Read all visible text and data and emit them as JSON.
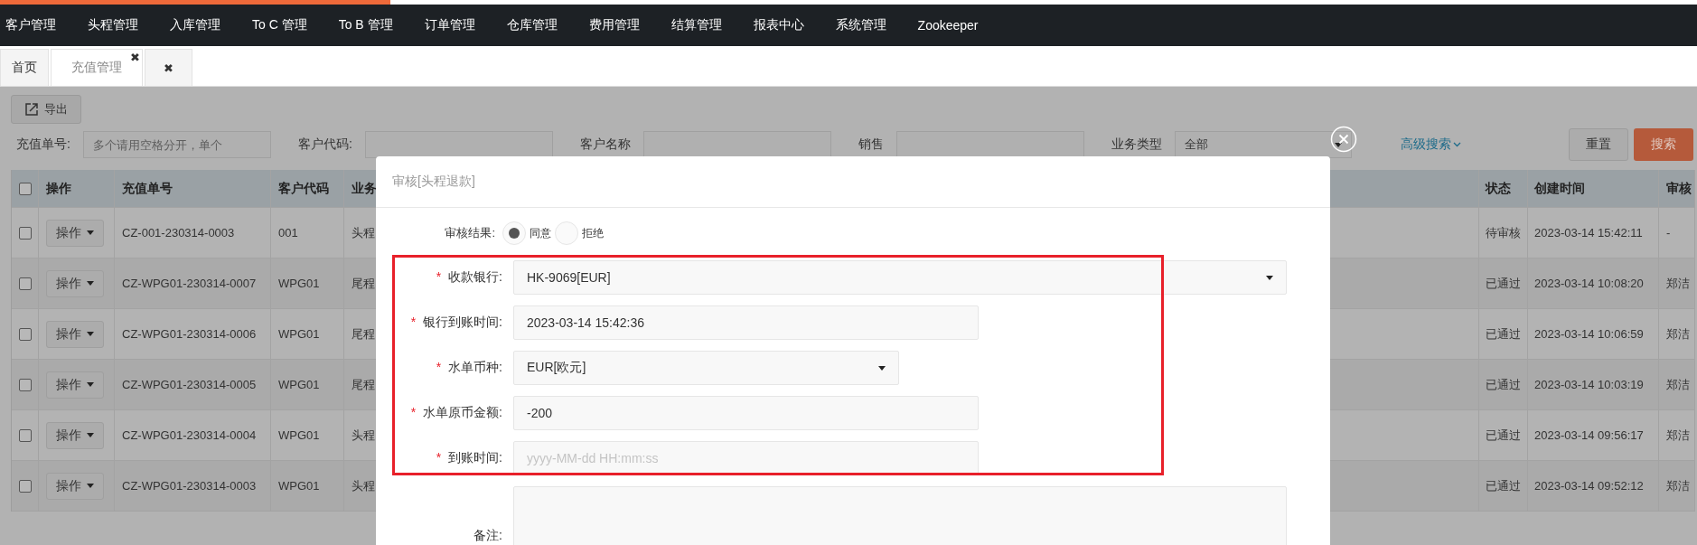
{
  "nav": {
    "items": [
      "客户管理",
      "头程管理",
      "入库管理",
      "To C 管理",
      "To B 管理",
      "订单管理",
      "仓库管理",
      "费用管理",
      "结算管理",
      "报表中心",
      "系统管理",
      "Zookeeper"
    ]
  },
  "tabs": [
    {
      "label": "首页",
      "selected": false
    },
    {
      "label": "充值管理",
      "selected": true,
      "close": "✖"
    },
    {
      "close": "✖",
      "selected": false
    }
  ],
  "toolbar": {
    "export_button": "导出"
  },
  "filters": [
    {
      "label": "充值单号:",
      "placeholder": "多个请用空格分开，单个"
    },
    {
      "label": "客户代码:"
    },
    {
      "label": "客户名称"
    },
    {
      "label": "销售"
    },
    {
      "label": "业务类型",
      "kind": "select",
      "value": "全部"
    }
  ],
  "advanced_search": "高级搜索",
  "reset_button": "重置",
  "search_button": "搜索",
  "table": {
    "select_all": {
      "checked": false
    },
    "columns": [
      "操作",
      "充值单号",
      "客户代码",
      "业务",
      "状态",
      "创建时间",
      "审核"
    ],
    "rows": [
      {
        "checked": false,
        "action": "操作",
        "order_no": "CZ-001-230314-0003",
        "customer_code": "001",
        "business": "头程",
        "status": "待审核",
        "created": "2023-03-14 15:42:11",
        "auditor": "-"
      },
      {
        "checked": false,
        "action": "操作",
        "order_no": "CZ-WPG01-230314-0007",
        "customer_code": "WPG01",
        "business": "尾程",
        "status": "已通过",
        "created": "2023-03-14 10:08:20",
        "auditor": "郑洁"
      },
      {
        "checked": false,
        "action": "操作",
        "order_no": "CZ-WPG01-230314-0006",
        "customer_code": "WPG01",
        "business": "尾程",
        "status": "已通过",
        "created": "2023-03-14 10:06:59",
        "auditor": "郑洁"
      },
      {
        "checked": false,
        "action": "操作",
        "order_no": "CZ-WPG01-230314-0005",
        "customer_code": "WPG01",
        "business": "尾程",
        "status": "已通过",
        "created": "2023-03-14 10:03:19",
        "auditor": "郑洁"
      },
      {
        "checked": false,
        "action": "操作",
        "order_no": "CZ-WPG01-230314-0004",
        "customer_code": "WPG01",
        "business": "头程",
        "status": "已通过",
        "created": "2023-03-14 09:56:17",
        "auditor": "郑洁"
      },
      {
        "checked": false,
        "action": "操作",
        "order_no": "CZ-WPG01-230314-0003",
        "customer_code": "WPG01",
        "business": "头程",
        "status": "已通过",
        "created": "2023-03-14 09:52:12",
        "auditor": "郑洁"
      }
    ]
  },
  "modal": {
    "title": "审核[头程退款]",
    "audit_result": {
      "label": "审核结果:",
      "options": [
        {
          "label": "同意",
          "selected": true
        },
        {
          "label": "拒绝",
          "selected": false
        }
      ]
    },
    "fields": [
      {
        "label": "收款银行:",
        "required_mark": "*",
        "kind": "select",
        "value": "HK-9069[EUR]"
      },
      {
        "label": "银行到账时间:",
        "required_mark": "*",
        "kind": "input",
        "value": "2023-03-14 15:42:36"
      },
      {
        "label": "水单币种:",
        "required_mark": "*",
        "kind": "select",
        "value": "EUR[欧元]"
      },
      {
        "label": "水单原币金额:",
        "required_mark": "*",
        "kind": "input",
        "value": "-200"
      },
      {
        "label": "到账时间:",
        "required_mark": "*",
        "kind": "input",
        "placeholder": "yyyy-MM-dd HH:mm:ss"
      }
    ],
    "remark": {
      "label": "备注:"
    }
  }
}
